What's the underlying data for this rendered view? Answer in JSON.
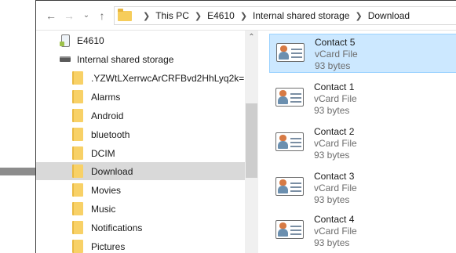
{
  "address_bar": {
    "crumbs": [
      "This PC",
      "E4610",
      "Internal shared storage",
      "Download"
    ]
  },
  "tree": {
    "items": [
      {
        "label": "E4610",
        "icon": "phone-device-icon",
        "level": 0
      },
      {
        "label": "Internal shared storage",
        "icon": "drive-icon",
        "level": 1
      },
      {
        "label": ".YZWtLXerrwcArCRFBvd2HhLyq2k=",
        "icon": "folder-icon",
        "level": 2
      },
      {
        "label": "Alarms",
        "icon": "folder-icon",
        "level": 2
      },
      {
        "label": "Android",
        "icon": "folder-icon",
        "level": 2
      },
      {
        "label": "bluetooth",
        "icon": "folder-icon",
        "level": 2
      },
      {
        "label": "DCIM",
        "icon": "folder-icon",
        "level": 2
      },
      {
        "label": "Download",
        "icon": "folder-icon",
        "level": 2,
        "selected": true
      },
      {
        "label": "Movies",
        "icon": "folder-icon",
        "level": 2
      },
      {
        "label": "Music",
        "icon": "folder-icon",
        "level": 2
      },
      {
        "label": "Notifications",
        "icon": "folder-icon",
        "level": 2
      },
      {
        "label": "Pictures",
        "icon": "folder-icon",
        "level": 2
      }
    ]
  },
  "files": [
    {
      "name": "Contact 5",
      "type": "vCard File",
      "size": "93 bytes",
      "selected": true
    },
    {
      "name": "Contact 1",
      "type": "vCard File",
      "size": "93 bytes"
    },
    {
      "name": "Contact 2",
      "type": "vCard File",
      "size": "93 bytes"
    },
    {
      "name": "Contact 3",
      "type": "vCard File",
      "size": "93 bytes"
    },
    {
      "name": "Contact 4",
      "type": "vCard File",
      "size": "93 bytes"
    }
  ],
  "colors": {
    "selection_bg": "#cce8ff",
    "tree_selected_bg": "#d9d9d9",
    "folder": "#f8d167",
    "pointer_arrow": "#8c8c8c"
  }
}
